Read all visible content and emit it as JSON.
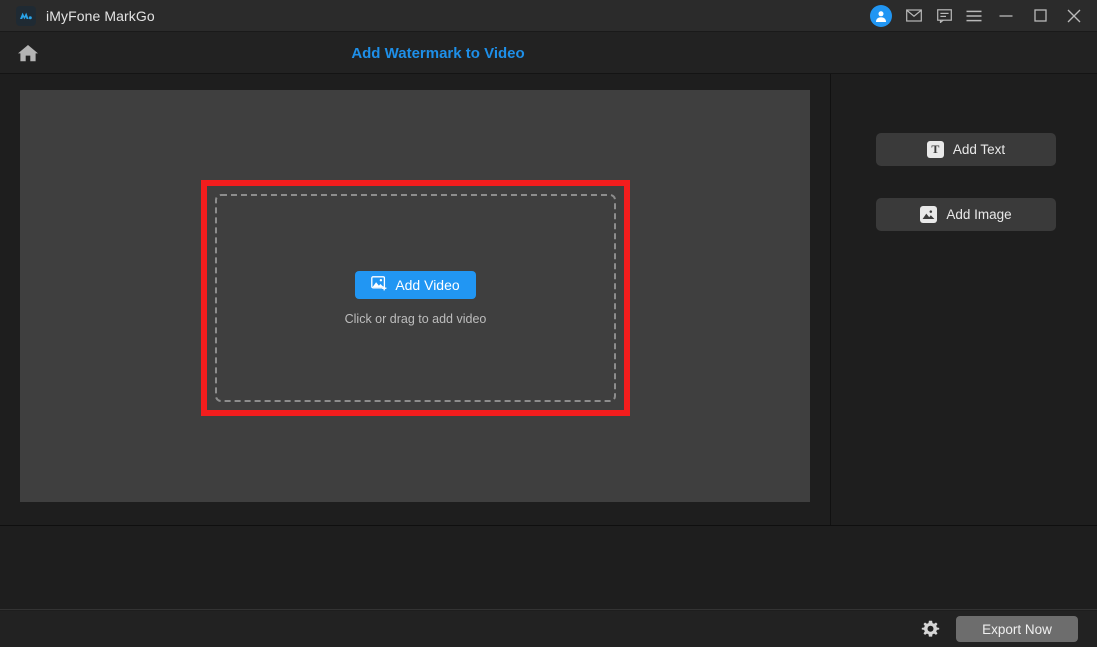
{
  "window": {
    "app_name": "iMyFone MarkGo",
    "logo_icon": "markgo-logo-icon",
    "controls": {
      "account_icon": "user-avatar-icon",
      "mail_icon": "envelope-icon",
      "feedback_icon": "chat-bubble-icon",
      "menu_icon": "hamburger-menu-icon",
      "minimize_icon": "minimize-icon",
      "maximize_icon": "maximize-icon",
      "close_icon": "close-icon"
    }
  },
  "header": {
    "home_icon": "home-icon",
    "title": "Add Watermark to Video",
    "title_color": "#1e8fe8"
  },
  "canvas": {
    "dropzone": {
      "button_label": "Add Video",
      "button_icon": "add-image-plus-icon",
      "button_color": "#2196f3",
      "hint": "Click or drag to add video"
    },
    "annotation": {
      "shape": "rectangle",
      "color": "#f21d1d"
    }
  },
  "right_panel": {
    "buttons": [
      {
        "label": "Add Text",
        "icon": "text-t-icon"
      },
      {
        "label": "Add Image",
        "icon": "picture-icon"
      }
    ]
  },
  "bottom_bar": {
    "settings_icon": "gear-icon",
    "export_label": "Export Now",
    "export_color": "#6d6d6d"
  }
}
